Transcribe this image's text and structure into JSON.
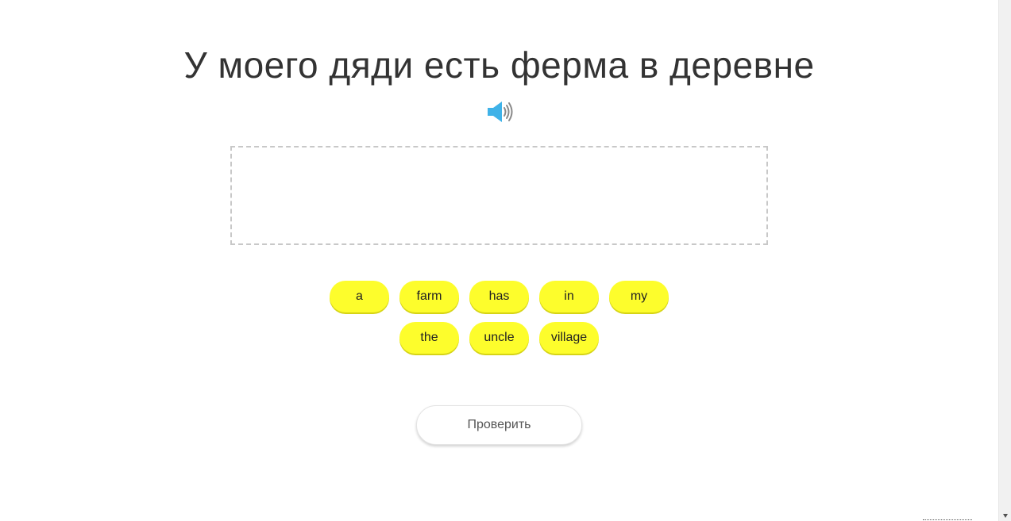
{
  "exercise": {
    "sentence": "У моего дяди есть ферма в деревне",
    "audio_icon": "speaker-icon",
    "answer_area": {
      "placed_words": []
    },
    "word_bank": {
      "row1": [
        "a",
        "farm",
        "has",
        "in",
        "my"
      ],
      "row2": [
        "the",
        "uncle",
        "village"
      ]
    },
    "check_button_label": "Проверить"
  },
  "colors": {
    "chip": "#fdfd2c",
    "speaker": "#3fb2e8",
    "text": "#333333"
  }
}
